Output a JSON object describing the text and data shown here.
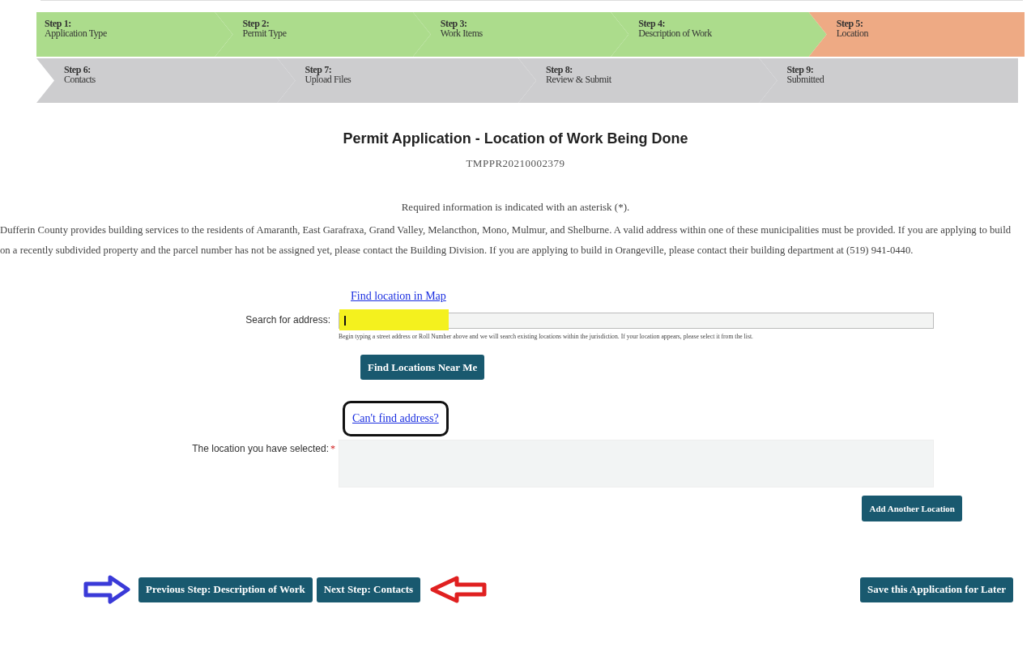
{
  "steps": [
    [
      {
        "number": "Step 1:",
        "label": "Application Type",
        "completed": true,
        "selected": false
      },
      {
        "number": "Step 2:",
        "label": "Permit Type",
        "completed": true,
        "selected": false
      },
      {
        "number": "Step 3:",
        "label": "Work Items",
        "completed": true,
        "selected": false
      },
      {
        "number": "Step 4:",
        "label": "Description of Work",
        "completed": true,
        "selected": false
      },
      {
        "number": "Step 5:",
        "label": "Location",
        "completed": false,
        "selected": true
      }
    ],
    [
      {
        "number": "Step 6:",
        "label": "Contacts",
        "completed": false,
        "selected": false
      },
      {
        "number": "Step 7:",
        "label": "Upload Files",
        "completed": false,
        "selected": false
      },
      {
        "number": "Step 8:",
        "label": "Review & Submit",
        "completed": false,
        "selected": false
      },
      {
        "number": "Step 9:",
        "label": "Submitted",
        "completed": false,
        "selected": false
      }
    ]
  ],
  "title": "Permit Application - Location of Work Being Done",
  "application_number": "TMPPR20210002379",
  "required_note": "Required information is indicated with an asterisk (*).",
  "intro": "Dufferin County provides building services to the residents of Amaranth, East Garafraxa, Grand Valley, Melancthon, Mono, Mulmur, and Shelburne. A valid address within one of these municipalities must be provided. If you are applying to build on a recently subdivided property and the parcel number has not be assigned yet, please contact the Building Division. If you are applying to build in Orangeville, please contact their building department at (519) 941-0440.",
  "map_link": "Find location in Map",
  "search": {
    "label": "Search for address:",
    "hint": "Begin typing a street address or Roll Number above and we will search existing locations within the jurisdiction. If your location appears, please select it from the list.",
    "highlighted": true
  },
  "near_me_button": "Find Locations Near Me",
  "cant_find_link": "Can't find address?",
  "selected_location": {
    "label": "The location you have selected:",
    "required_mark": "*"
  },
  "add_location_button": "Add Another Location",
  "footer_buttons": {
    "previous": "Previous Step: Description of Work",
    "next": "Next Step: Contacts",
    "save": "Save this Application for Later"
  }
}
